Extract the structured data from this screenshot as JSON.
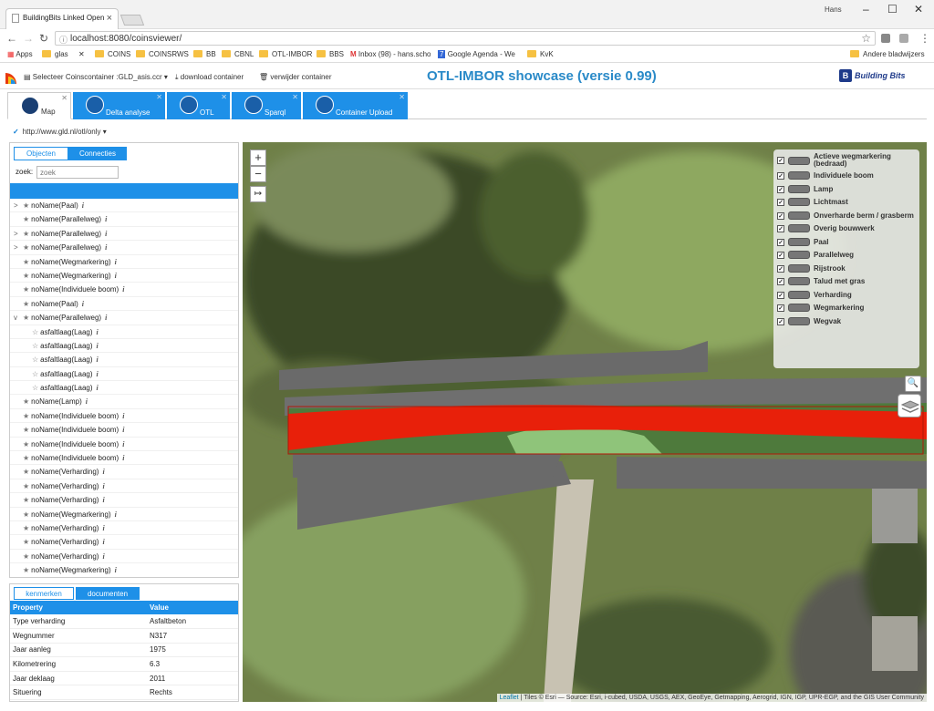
{
  "browser": {
    "tab_title": "BuildingBits Linked Open",
    "user": "Hans",
    "url": "localhost:8080/coinsviewer/",
    "bookmarks": [
      "Apps",
      "glas",
      "COINS",
      "COINSRWS",
      "BB",
      "CBNL",
      "OTL-IMBOR",
      "BBS",
      "Inbox (98) - hans.scho",
      "Google Agenda - We",
      "KvK",
      "Andere bladwijzers"
    ]
  },
  "toolbar": {
    "select_container": "Selecteer Coinscontainer :GLD_asis.ccr",
    "download": "download container",
    "remove": "verwijder container",
    "title": "OTL-IMBOR showcase (versie 0.99)",
    "brand": "Building Bits"
  },
  "tabs": [
    "Map",
    "Delta analyse",
    "OTL",
    "Sparql",
    "Container Upload"
  ],
  "namespace": "http://www.gld.nl/otl/only",
  "left": {
    "tab_objects": "Objecten",
    "tab_connections": "Connecties",
    "search_label": "zoek:",
    "search_placeholder": "zoek",
    "tree": [
      {
        "label": "noName(Paal)",
        "arrow": ">",
        "star": "★",
        "indent": 0
      },
      {
        "label": "noName(Parallelweg)",
        "arrow": "",
        "star": "★",
        "indent": 0
      },
      {
        "label": "noName(Parallelweg)",
        "arrow": ">",
        "star": "★",
        "indent": 0
      },
      {
        "label": "noName(Parallelweg)",
        "arrow": ">",
        "star": "★",
        "indent": 0
      },
      {
        "label": "noName(Wegmarkering)",
        "arrow": "",
        "star": "★",
        "indent": 0
      },
      {
        "label": "noName(Wegmarkering)",
        "arrow": "",
        "star": "★",
        "indent": 0
      },
      {
        "label": "noName(Individuele boom)",
        "arrow": "",
        "star": "★",
        "indent": 0
      },
      {
        "label": "noName(Paal)",
        "arrow": "",
        "star": "★",
        "indent": 0
      },
      {
        "label": "noName(Parallelweg)",
        "arrow": "v",
        "star": "★",
        "indent": 0
      },
      {
        "label": "asfaltlaag(Laag)",
        "arrow": "",
        "star": "☆",
        "indent": 1
      },
      {
        "label": "asfaltlaag(Laag)",
        "arrow": "",
        "star": "☆",
        "indent": 1
      },
      {
        "label": "asfaltlaag(Laag)",
        "arrow": "",
        "star": "☆",
        "indent": 1
      },
      {
        "label": "asfaltlaag(Laag)",
        "arrow": "",
        "star": "☆",
        "indent": 1
      },
      {
        "label": "asfaltlaag(Laag)",
        "arrow": "",
        "star": "☆",
        "indent": 1
      },
      {
        "label": "noName(Lamp)",
        "arrow": "",
        "star": "★",
        "indent": 0
      },
      {
        "label": "noName(Individuele boom)",
        "arrow": "",
        "star": "★",
        "indent": 0
      },
      {
        "label": "noName(Individuele boom)",
        "arrow": "",
        "star": "★",
        "indent": 0
      },
      {
        "label": "noName(Individuele boom)",
        "arrow": "",
        "star": "★",
        "indent": 0
      },
      {
        "label": "noName(Individuele boom)",
        "arrow": "",
        "star": "★",
        "indent": 0
      },
      {
        "label": "noName(Verharding)",
        "arrow": "",
        "star": "★",
        "indent": 0
      },
      {
        "label": "noName(Verharding)",
        "arrow": "",
        "star": "★",
        "indent": 0
      },
      {
        "label": "noName(Verharding)",
        "arrow": "",
        "star": "★",
        "indent": 0
      },
      {
        "label": "noName(Wegmarkering)",
        "arrow": "",
        "star": "★",
        "indent": 0
      },
      {
        "label": "noName(Verharding)",
        "arrow": "",
        "star": "★",
        "indent": 0
      },
      {
        "label": "noName(Verharding)",
        "arrow": "",
        "star": "★",
        "indent": 0
      },
      {
        "label": "noName(Verharding)",
        "arrow": "",
        "star": "★",
        "indent": 0
      },
      {
        "label": "noName(Wegmarkering)",
        "arrow": "",
        "star": "★",
        "indent": 0
      }
    ]
  },
  "props": {
    "tab_kenmerken": "kenmerken",
    "tab_documenten": "documenten",
    "header": [
      "Property",
      "Value"
    ],
    "rows": [
      [
        "Type verharding",
        "Asfaltbeton"
      ],
      [
        "Wegnummer",
        "N317"
      ],
      [
        "Jaar aanleg",
        "1975"
      ],
      [
        "Kilometrering",
        "6.3"
      ],
      [
        "Jaar deklaag",
        "2011"
      ],
      [
        "Situering",
        "Rechts"
      ]
    ]
  },
  "map": {
    "zoom_in": "+",
    "zoom_out": "−",
    "legend": [
      "Actieve wegmarkering (bedraad)",
      "Individuele boom",
      "Lamp",
      "Lichtmast",
      "Onverharde berm / grasberm",
      "Overig bouwwerk",
      "Paal",
      "Parallelweg",
      "Rijstrook",
      "Talud met gras",
      "Verharding",
      "Wegmarkering",
      "Wegvak"
    ],
    "attribution_link": "Leaflet",
    "attribution": " | Tiles © Esri — Source: Esri, i-cubed, USDA, USGS, AEX, GeoEye, Getmapping, Aerogrid, IGN, IGP, UPR-EGP, and the GIS User Community",
    "colors": {
      "highlight": "#e8200a",
      "road": "#6a6a6a",
      "grass": "#4e7a3c",
      "lightgrass": "#8fc47a"
    }
  }
}
